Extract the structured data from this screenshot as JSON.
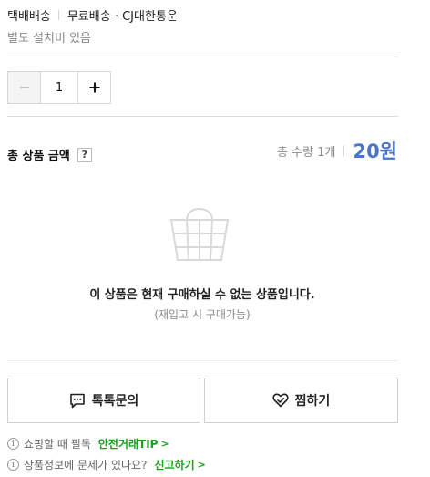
{
  "delivery": {
    "method": "택배배송",
    "detail": "무료배송 · CJ대한통운",
    "install_note": "별도 설치비 있음"
  },
  "quantity": {
    "value": "1",
    "minus_icon": "minus-icon",
    "plus_icon": "plus-icon"
  },
  "total": {
    "label": "총 상품 금액",
    "help": "?",
    "qty_text": "총 수량 1개",
    "price": "20원",
    "price_color": "#4a74c9"
  },
  "unavailable": {
    "icon": "shopping-basket-icon",
    "message": "이 상품은 현재 구매하실 수 없는 상품입니다.",
    "sub": "(재입고 시 구매가능)"
  },
  "actions": {
    "talk_label": "톡톡문의",
    "talk_icon": "chat-bubble-icon",
    "wish_label": "찜하기",
    "wish_icon": "heart-icon"
  },
  "footer": {
    "safe_text": "쇼핑할 때 필독",
    "safe_link": "안전거래TIP",
    "report_text": "상품정보에 문제가 있나요?",
    "report_link": "신고하기",
    "link_color": "#14a31b"
  }
}
